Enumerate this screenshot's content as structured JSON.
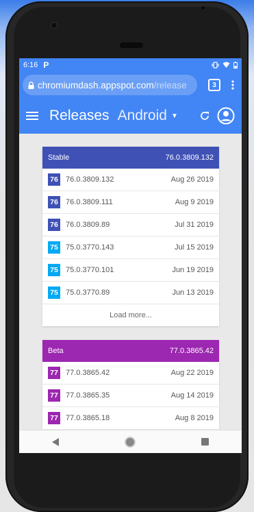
{
  "status_bar": {
    "time": "6:16",
    "notification_icon": "P"
  },
  "browser": {
    "url_host": "chromiumdash.appspot.com",
    "url_path": "/release",
    "tab_count": "3"
  },
  "app_bar": {
    "title": "Releases",
    "platform": "Android"
  },
  "colors": {
    "primary": "#4285f4",
    "stable": "#3f51b5",
    "beta": "#9c27b0",
    "badge_76": "#3f51b5",
    "badge_75": "#03a9f4",
    "badge_77": "#9c27b0"
  },
  "stable": {
    "label": "Stable",
    "version": "76.0.3809.132",
    "rows": [
      {
        "milestone": "76",
        "version": "76.0.3809.132",
        "date": "Aug 26 2019"
      },
      {
        "milestone": "76",
        "version": "76.0.3809.111",
        "date": "Aug 9 2019"
      },
      {
        "milestone": "76",
        "version": "76.0.3809.89",
        "date": "Jul 31 2019"
      },
      {
        "milestone": "75",
        "version": "75.0.3770.143",
        "date": "Jul 15 2019"
      },
      {
        "milestone": "75",
        "version": "75.0.3770.101",
        "date": "Jun 19 2019"
      },
      {
        "milestone": "75",
        "version": "75.0.3770.89",
        "date": "Jun 13 2019"
      }
    ],
    "load_more": "Load more..."
  },
  "beta": {
    "label": "Beta",
    "version": "77.0.3865.42",
    "rows": [
      {
        "milestone": "77",
        "version": "77.0.3865.42",
        "date": "Aug 22 2019"
      },
      {
        "milestone": "77",
        "version": "77.0.3865.35",
        "date": "Aug 14 2019"
      },
      {
        "milestone": "77",
        "version": "77.0.3865.18",
        "date": "Aug 8 2019"
      }
    ]
  }
}
